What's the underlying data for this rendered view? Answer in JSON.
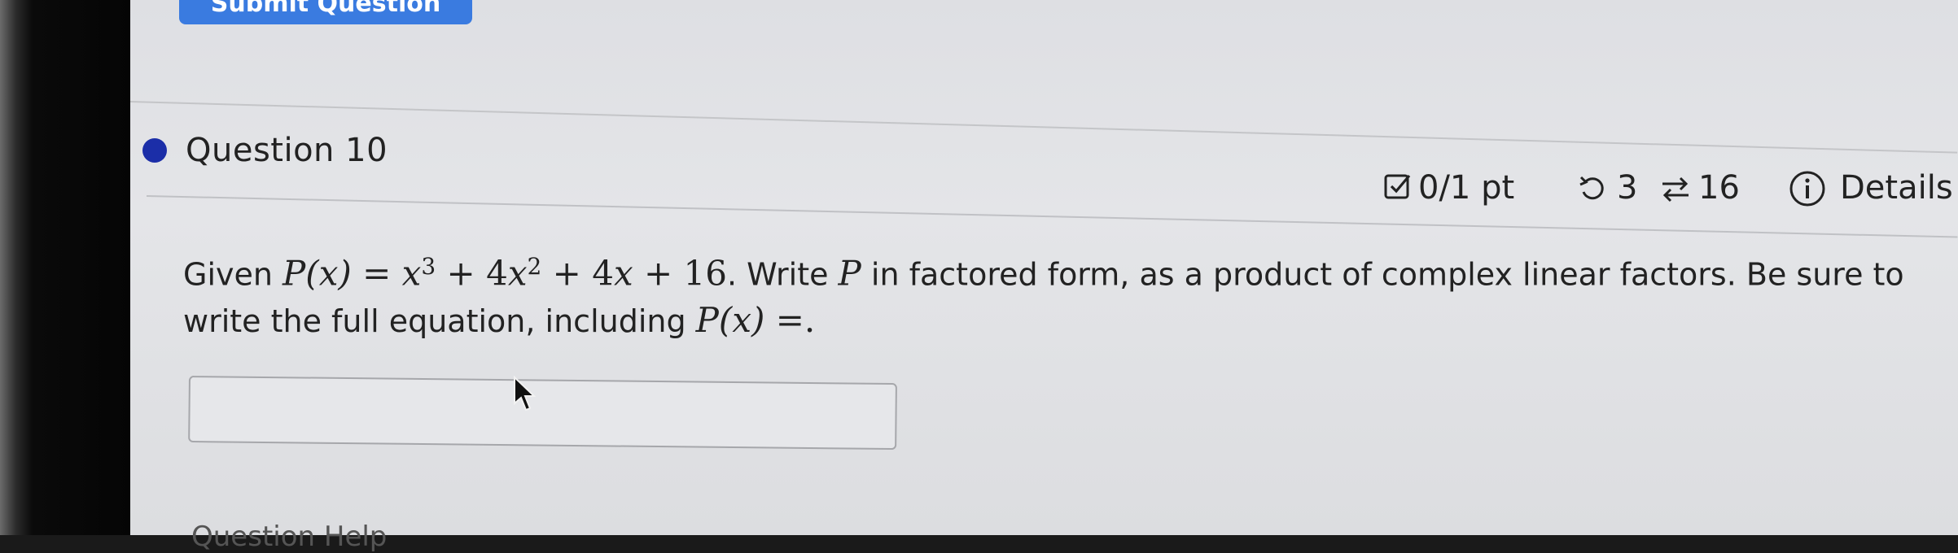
{
  "submit_button": {
    "label": "Submit Question"
  },
  "question": {
    "title": "Question 10",
    "score": "0/1 pt",
    "retries": "3",
    "attempts": "16",
    "details_label": "Details"
  },
  "prompt": {
    "given": "Given ",
    "px": "P(x)",
    "eq": " = ",
    "x3": "x",
    "exp3": "3",
    "plus1": " + 4",
    "x2": "x",
    "exp2": "2",
    "plus2": " + 4",
    "x1": "x",
    "plus3": " + 16",
    "mid": ". Write ",
    "p": "P",
    "rest": " in factored form, as a product of complex linear factors. Be sure to write the full equation, including ",
    "px2": "P(x)",
    "tail": " =."
  },
  "answer": {
    "value": "",
    "placeholder": ""
  },
  "bottom": {
    "label": "Question Help"
  },
  "colors": {
    "accent": "#3a7be0",
    "status_dot": "#1b2ea8"
  }
}
